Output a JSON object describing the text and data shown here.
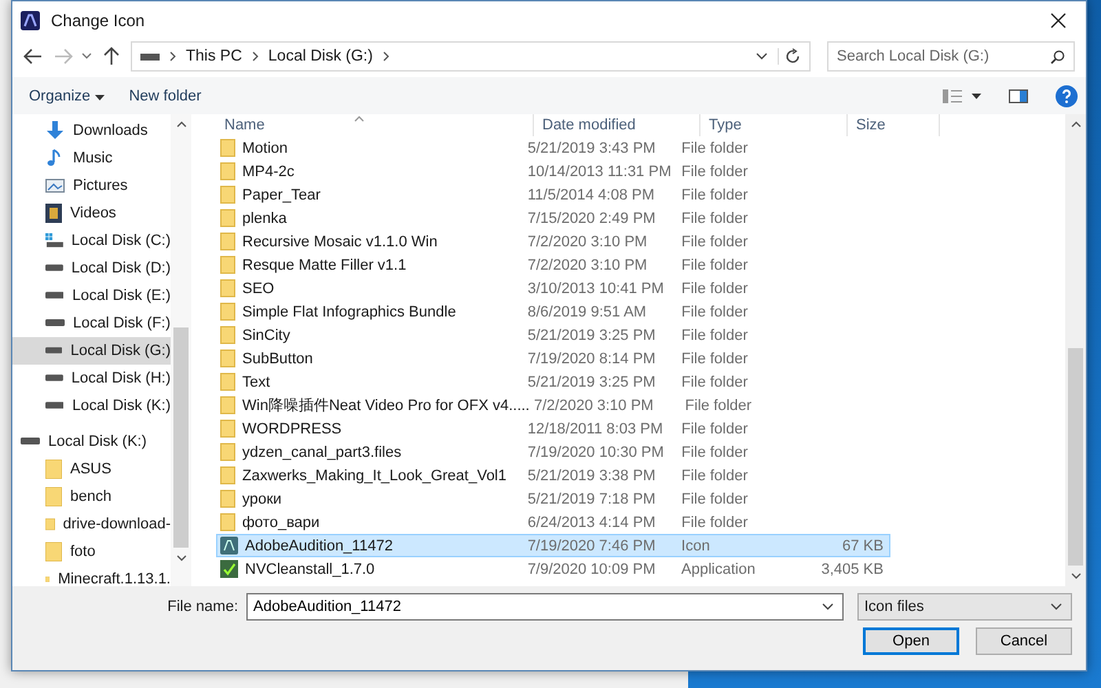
{
  "window": {
    "title": "Change Icon"
  },
  "address_bar": {
    "crumbs": [
      "This PC",
      "Local Disk (G:)"
    ]
  },
  "search": {
    "placeholder": "Search Local Disk (G:)"
  },
  "toolbar": {
    "organize": "Organize",
    "new_folder": "New folder"
  },
  "sidebar": {
    "items": [
      {
        "label": "Downloads",
        "kind": "download",
        "selected": false
      },
      {
        "label": "Music",
        "kind": "music",
        "selected": false
      },
      {
        "label": "Pictures",
        "kind": "pictures",
        "selected": false
      },
      {
        "label": "Videos",
        "kind": "videos",
        "selected": false
      },
      {
        "label": "Local Disk (C:)",
        "kind": "system-drive",
        "selected": false
      },
      {
        "label": "Local Disk (D:)",
        "kind": "drive",
        "selected": false
      },
      {
        "label": "Local Disk (E:)",
        "kind": "drive",
        "selected": false
      },
      {
        "label": "Local Disk (F:)",
        "kind": "drive",
        "selected": false
      },
      {
        "label": "Local Disk (G:)",
        "kind": "drive",
        "selected": true
      },
      {
        "label": "Local Disk (H:)",
        "kind": "drive",
        "selected": false
      },
      {
        "label": "Local Disk (K:)",
        "kind": "drive",
        "selected": false
      },
      {
        "label": "Local Disk (K:)",
        "kind": "drive",
        "selected": false,
        "children": [
          {
            "label": "ASUS",
            "kind": "folder",
            "selected": false
          },
          {
            "label": "bench",
            "kind": "folder",
            "selected": false
          },
          {
            "label": "drive-download-",
            "kind": "folder",
            "selected": false
          },
          {
            "label": "foto",
            "kind": "folder",
            "selected": false
          },
          {
            "label": "Minecraft.1.13.1.",
            "kind": "folder",
            "selected": false
          }
        ]
      }
    ]
  },
  "table": {
    "columns": [
      "Name",
      "Date modified",
      "Type",
      "Size"
    ],
    "rows": [
      {
        "name": "Motion",
        "date": "5/21/2019 3:43 PM",
        "type": "File folder",
        "kind": "folder",
        "selected": false
      },
      {
        "name": "MP4-2c",
        "date": "10/14/2013 11:31 PM",
        "type": "File folder",
        "kind": "folder",
        "selected": false
      },
      {
        "name": "Paper_Tear",
        "date": "11/5/2014 4:08 PM",
        "type": "File folder",
        "kind": "folder",
        "selected": false
      },
      {
        "name": "plenka",
        "date": "7/15/2020 2:49 PM",
        "type": "File folder",
        "kind": "folder",
        "selected": false
      },
      {
        "name": "Recursive Mosaic v1.1.0 Win",
        "date": "7/2/2020 3:10 PM",
        "type": "File folder",
        "kind": "folder",
        "selected": false
      },
      {
        "name": "Resque Matte Filler v1.1",
        "date": "7/2/2020 3:10 PM",
        "type": "File folder",
        "kind": "folder",
        "selected": false
      },
      {
        "name": "SEO",
        "date": "3/10/2013 10:41 PM",
        "type": "File folder",
        "kind": "folder",
        "selected": false
      },
      {
        "name": "Simple Flat Infographics Bundle",
        "date": "8/6/2019 9:51 AM",
        "type": "File folder",
        "kind": "folder",
        "selected": false
      },
      {
        "name": "SinCity",
        "date": "5/21/2019 3:25 PM",
        "type": "File folder",
        "kind": "folder",
        "selected": false
      },
      {
        "name": "SubButton",
        "date": "7/19/2020 8:14 PM",
        "type": "File folder",
        "kind": "folder",
        "selected": false
      },
      {
        "name": "Text",
        "date": "5/21/2019 3:25 PM",
        "type": "File folder",
        "kind": "folder",
        "selected": false
      },
      {
        "name": "Win降噪插件Neat Video Pro for OFX v4.....",
        "date": "7/2/2020 3:10 PM",
        "type": "File folder",
        "kind": "folder",
        "selected": false
      },
      {
        "name": "WORDPRESS",
        "date": "12/18/2011 8:03 PM",
        "type": "File folder",
        "kind": "folder",
        "selected": false
      },
      {
        "name": "ydzen_canal_part3.files",
        "date": "7/19/2020 10:30 PM",
        "type": "File folder",
        "kind": "folder",
        "selected": false
      },
      {
        "name": "Zaxwerks_Making_It_Look_Great_Vol1",
        "date": "5/21/2019 3:38 PM",
        "type": "File folder",
        "kind": "folder",
        "selected": false
      },
      {
        "name": "уроки",
        "date": "5/21/2019 7:18 PM",
        "type": "File folder",
        "kind": "folder",
        "selected": false
      },
      {
        "name": "фото_вари",
        "date": "6/24/2013 4:14 PM",
        "type": "File folder",
        "kind": "folder",
        "selected": false
      },
      {
        "name": "AdobeAudition_11472",
        "date": "7/19/2020 7:46 PM",
        "type": "Icon",
        "size": "67 KB",
        "kind": "icon-file",
        "selected": true
      },
      {
        "name": "NVCleanstall_1.7.0",
        "date": "7/9/2020 10:09 PM",
        "type": "Application",
        "size": "3,405 KB",
        "kind": "application",
        "selected": false
      }
    ]
  },
  "footer": {
    "file_name_label": "File name:",
    "file_name": "AdobeAudition_11472",
    "filter": "Icon files",
    "buttons": [
      "Open",
      "Cancel"
    ]
  }
}
